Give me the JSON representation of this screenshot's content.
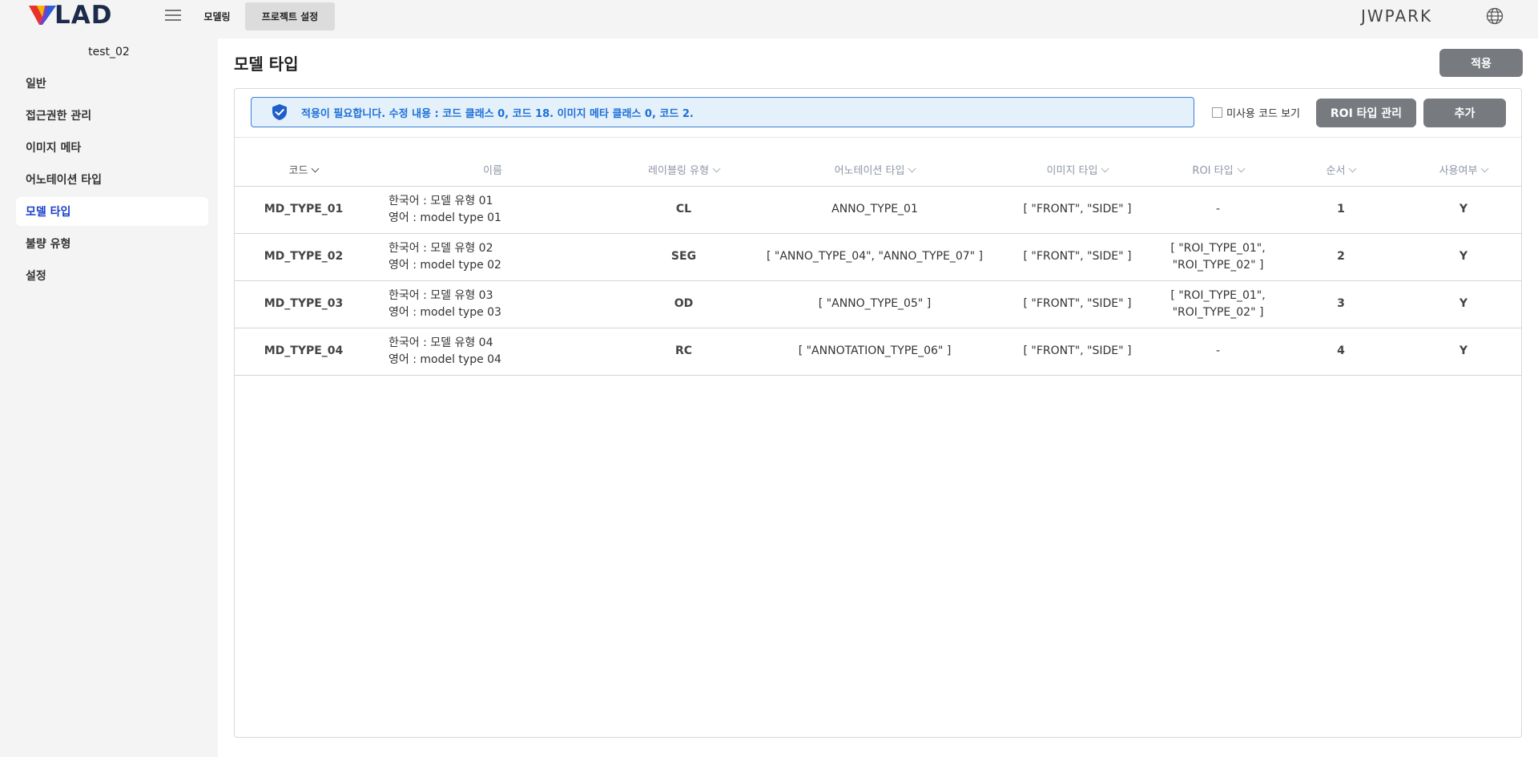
{
  "header": {
    "logo_text": "LAD",
    "nav": [
      {
        "label": "모델링"
      },
      {
        "label": "프로젝트 설정"
      }
    ],
    "user": "JWPARK"
  },
  "sidebar": {
    "project_name": "test_02",
    "items": [
      {
        "label": "일반"
      },
      {
        "label": "접근권한 관리"
      },
      {
        "label": "이미지 메타"
      },
      {
        "label": "어노테이션 타입"
      },
      {
        "label": "모델 타입"
      },
      {
        "label": "불량 유형"
      },
      {
        "label": "설정"
      }
    ],
    "active_index": 4
  },
  "main": {
    "title": "모델 타입",
    "apply_label": "적용",
    "notice": "적용이 필요합니다. 수정 내용 : 코드 클래스 0, 코드 18. 이미지 메타 클래스 0, 코드 2.",
    "unused_label": "미사용 코드 보기",
    "roi_button": "ROI 타입 관리",
    "add_button": "추가"
  },
  "table": {
    "columns": [
      "코드",
      "이름",
      "레이블링 유형",
      "어노테이션 타입",
      "이미지 타입",
      "ROI 타입",
      "순서",
      "사용여부"
    ],
    "rows": [
      {
        "code": "MD_TYPE_01",
        "name_ko": "한국어 : 모델 유형 01",
        "name_en": "영어 : model type 01",
        "label_type": "CL",
        "anno": "ANNO_TYPE_01",
        "image": "[ \"FRONT\", \"SIDE\" ]",
        "roi1": "-",
        "roi2": "",
        "order": "1",
        "use": "Y"
      },
      {
        "code": "MD_TYPE_02",
        "name_ko": "한국어 : 모델 유형 02",
        "name_en": "영어 : model type 02",
        "label_type": "SEG",
        "anno": "[ \"ANNO_TYPE_04\", \"ANNO_TYPE_07\" ]",
        "image": "[ \"FRONT\", \"SIDE\" ]",
        "roi1": "[ \"ROI_TYPE_01\",",
        "roi2": "\"ROI_TYPE_02\" ]",
        "order": "2",
        "use": "Y"
      },
      {
        "code": "MD_TYPE_03",
        "name_ko": "한국어 : 모델 유형 03",
        "name_en": "영어 : model type 03",
        "label_type": "OD",
        "anno": "[ \"ANNO_TYPE_05\" ]",
        "image": "[ \"FRONT\", \"SIDE\" ]",
        "roi1": "[ \"ROI_TYPE_01\",",
        "roi2": "\"ROI_TYPE_02\" ]",
        "order": "3",
        "use": "Y"
      },
      {
        "code": "MD_TYPE_04",
        "name_ko": "한국어 : 모델 유형 04",
        "name_en": "영어 : model type 04",
        "label_type": "RC",
        "anno": "[ \"ANNOTATION_TYPE_06\" ]",
        "image": "[ \"FRONT\", \"SIDE\" ]",
        "roi1": "-",
        "roi2": "",
        "order": "4",
        "use": "Y"
      }
    ]
  },
  "colors": {
    "accent": "#1a3fc7",
    "notice_bg": "#e4f1fb",
    "notice_text": "#1d6fd8",
    "button_gray": "#777b80"
  }
}
